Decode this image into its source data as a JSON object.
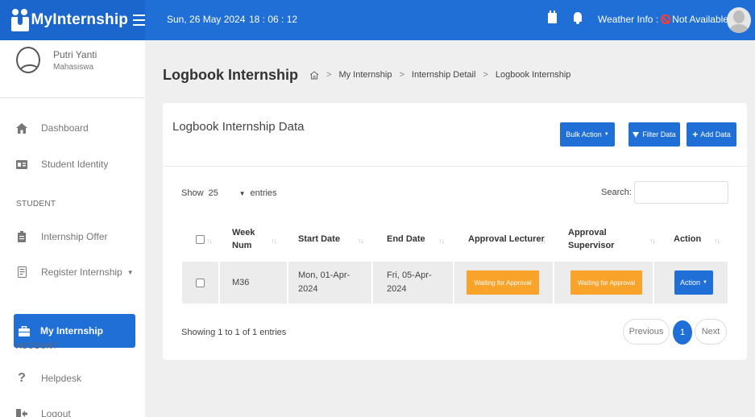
{
  "topbar": {
    "brand": "MyInternship",
    "date": "Sun, 26 May 2024",
    "time": "18 : 06 : 12",
    "weather_label": "Weather Info :",
    "weather_value": "Not Available",
    "accent": "#1f6fd6"
  },
  "user": {
    "name": "Putri Yanti",
    "role": "Mahasiswa"
  },
  "sidebar": {
    "dashboard": "Dashboard",
    "student_identity": "Student Identity",
    "section_student": "STUDENT",
    "internship_offer": "Internship Offer",
    "register_internship": "Register Internship",
    "my_internship": "My Internship",
    "section_account": "ACCOUNT",
    "helpdesk": "Helpdesk",
    "logout": "Logout"
  },
  "page": {
    "title": "Logbook Internship",
    "breadcrumb": [
      "My Internship",
      "Internship Detail",
      "Logbook Internship"
    ]
  },
  "card": {
    "title": "Logbook Internship Data",
    "bulk_action": "Bulk Action",
    "filter": "Filter Data",
    "add": "Add Data",
    "show_label": "Show",
    "entries_value": "25",
    "entries_label": "entries",
    "search_label": "Search:",
    "search_value": ""
  },
  "table": {
    "headers": {
      "week_1": "Week",
      "week_2": "Num",
      "start": "Start Date",
      "end": "End Date",
      "approval_lecturer": "Approval Lecturer",
      "approval_supervisor_1": "Approval",
      "approval_supervisor_2": "Supervisor",
      "action": "Action"
    },
    "rows": [
      {
        "week": "M36",
        "start_1": "Mon, 01-Apr-",
        "start_2": "2024",
        "end_1": "Fri, 05-Apr-",
        "end_2": "2024",
        "approval_lecturer": "Waiting for Approval",
        "approval_supervisor": "Waiting for Approval",
        "action": "Action"
      }
    ],
    "status_color": "#f9a32a"
  },
  "footer": {
    "showing": "Showing 1 to 1 of 1 entries",
    "previous": "Previous",
    "page": "1",
    "next": "Next"
  }
}
